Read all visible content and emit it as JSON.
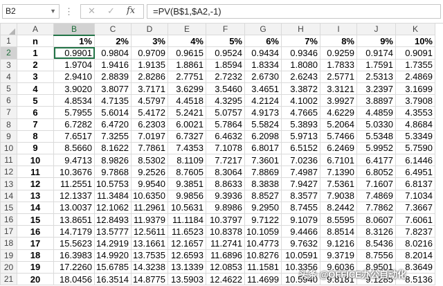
{
  "formula_bar": {
    "name_box": "B2",
    "cancel_icon": "close-icon",
    "enter_icon": "check-icon",
    "fx_label": "fx",
    "formula": "=PV(B$1,$A2,-1)"
  },
  "columns": [
    "A",
    "B",
    "C",
    "D",
    "E",
    "F",
    "G",
    "H",
    "I",
    "J",
    "K"
  ],
  "header_row": [
    "n",
    "1%",
    "2%",
    "3%",
    "4%",
    "5%",
    "6%",
    "7%",
    "8%",
    "9%",
    "10%"
  ],
  "rows": [
    {
      "n": "1",
      "values": [
        "0.9901",
        "0.9804",
        "0.9709",
        "0.9615",
        "0.9524",
        "0.9434",
        "0.9346",
        "0.9259",
        "0.9174",
        "0.9091"
      ]
    },
    {
      "n": "2",
      "values": [
        "1.9704",
        "1.9416",
        "1.9135",
        "1.8861",
        "1.8594",
        "1.8334",
        "1.8080",
        "1.7833",
        "1.7591",
        "1.7355"
      ]
    },
    {
      "n": "3",
      "values": [
        "2.9410",
        "2.8839",
        "2.8286",
        "2.7751",
        "2.7232",
        "2.6730",
        "2.6243",
        "2.5771",
        "2.5313",
        "2.4869"
      ]
    },
    {
      "n": "4",
      "values": [
        "3.9020",
        "3.8077",
        "3.7171",
        "3.6299",
        "3.5460",
        "3.4651",
        "3.3872",
        "3.3121",
        "3.2397",
        "3.1699"
      ]
    },
    {
      "n": "5",
      "values": [
        "4.8534",
        "4.7135",
        "4.5797",
        "4.4518",
        "4.3295",
        "4.2124",
        "4.1002",
        "3.9927",
        "3.8897",
        "3.7908"
      ]
    },
    {
      "n": "6",
      "values": [
        "5.7955",
        "5.6014",
        "5.4172",
        "5.2421",
        "5.0757",
        "4.9173",
        "4.7665",
        "4.6229",
        "4.4859",
        "4.3553"
      ]
    },
    {
      "n": "7",
      "values": [
        "6.7282",
        "6.4720",
        "6.2303",
        "6.0021",
        "5.7864",
        "5.5824",
        "5.3893",
        "5.2064",
        "5.0330",
        "4.8684"
      ]
    },
    {
      "n": "8",
      "values": [
        "7.6517",
        "7.3255",
        "7.0197",
        "6.7327",
        "6.4632",
        "6.2098",
        "5.9713",
        "5.7466",
        "5.5348",
        "5.3349"
      ]
    },
    {
      "n": "9",
      "values": [
        "8.5660",
        "8.1622",
        "7.7861",
        "7.4353",
        "7.1078",
        "6.8017",
        "6.5152",
        "6.2469",
        "5.9952",
        "5.7590"
      ]
    },
    {
      "n": "10",
      "values": [
        "9.4713",
        "8.9826",
        "8.5302",
        "8.1109",
        "7.7217",
        "7.3601",
        "7.0236",
        "6.7101",
        "6.4177",
        "6.1446"
      ]
    },
    {
      "n": "11",
      "values": [
        "10.3676",
        "9.7868",
        "9.2526",
        "8.7605",
        "8.3064",
        "7.8869",
        "7.4987",
        "7.1390",
        "6.8052",
        "6.4951"
      ]
    },
    {
      "n": "12",
      "values": [
        "11.2551",
        "10.5753",
        "9.9540",
        "9.3851",
        "8.8633",
        "8.3838",
        "7.9427",
        "7.5361",
        "7.1607",
        "6.8137"
      ]
    },
    {
      "n": "13",
      "values": [
        "12.1337",
        "11.3484",
        "10.6350",
        "9.9856",
        "9.3936",
        "8.8527",
        "8.3577",
        "7.9038",
        "7.4869",
        "7.1034"
      ]
    },
    {
      "n": "14",
      "values": [
        "13.0037",
        "12.1062",
        "11.2961",
        "10.5631",
        "9.8986",
        "9.2950",
        "8.7455",
        "8.2442",
        "7.7862",
        "7.3667"
      ]
    },
    {
      "n": "15",
      "values": [
        "13.8651",
        "12.8493",
        "11.9379",
        "11.1184",
        "10.3797",
        "9.7122",
        "9.1079",
        "8.5595",
        "8.0607",
        "7.6061"
      ]
    },
    {
      "n": "16",
      "values": [
        "14.7179",
        "13.5777",
        "12.5611",
        "11.6523",
        "10.8378",
        "10.1059",
        "9.4466",
        "8.8514",
        "8.3126",
        "7.8237"
      ]
    },
    {
      "n": "17",
      "values": [
        "15.5623",
        "14.2919",
        "13.1661",
        "12.1657",
        "11.2741",
        "10.4773",
        "9.7632",
        "9.1216",
        "8.5436",
        "8.0216"
      ]
    },
    {
      "n": "18",
      "values": [
        "16.3983",
        "14.9920",
        "13.7535",
        "12.6593",
        "11.6896",
        "10.8276",
        "10.0591",
        "9.3719",
        "8.7556",
        "8.2014"
      ]
    },
    {
      "n": "19",
      "values": [
        "17.2260",
        "15.6785",
        "14.3238",
        "13.1339",
        "12.0853",
        "11.1581",
        "10.3356",
        "9.6036",
        "8.9501",
        "8.3649"
      ]
    },
    {
      "n": "20",
      "values": [
        "18.0456",
        "16.3514",
        "14.8775",
        "13.5903",
        "12.4622",
        "11.4699",
        "10.5940",
        "9.8181",
        "9.1285",
        "8.5136"
      ]
    }
  ],
  "watermark": "头条 @OFFICE办公自动化"
}
